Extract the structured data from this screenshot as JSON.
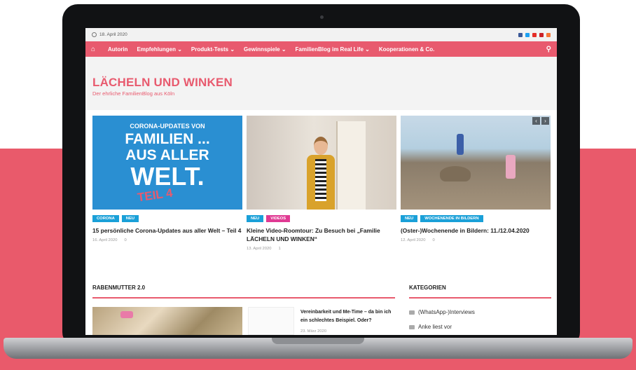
{
  "colors": {
    "accent": "#e85a6e",
    "band": "#e95a6b",
    "tag_blue": "#1aa0d8",
    "tag_pink": "#e03a93"
  },
  "topbar": {
    "date": "18. April 2020",
    "social_icons": [
      "facebook-icon",
      "twitter-icon",
      "youtube-icon",
      "pinterest-icon",
      "instagram-icon"
    ]
  },
  "nav": {
    "items": [
      "Autorin",
      "Empfehlungen ⌄",
      "Produkt-Tests ⌄",
      "Gewinnspiele ⌄",
      "FamilienBlog im Real Life ⌄",
      "Kooperationen & Co."
    ]
  },
  "site": {
    "title": "LÄCHELN UND WINKEN",
    "tagline": "Der ehrliche FamilienBlog aus Köln"
  },
  "features": [
    {
      "image_text": [
        "CORONA-UPDATES VON",
        "FAMILIEN ...",
        "AUS ALLER",
        "WELT.",
        "TEIL 4"
      ],
      "tags": [
        {
          "label": "CORONA",
          "color": "#1aa0d8"
        },
        {
          "label": "NEU",
          "color": "#1aa0d8"
        }
      ],
      "title": "15 persönliche Corona-Updates aus aller Welt – Teil 4",
      "date": "16. April 2020",
      "comments": "0"
    },
    {
      "tags": [
        {
          "label": "NEU",
          "color": "#1aa0d8"
        },
        {
          "label": "VIDEOS",
          "color": "#e03a93"
        }
      ],
      "title": "Kleine Video-Roomtour: Zu Besuch bei „Familie LÄCHELN UND WINKEN“",
      "date": "13. April 2020",
      "comments": "1"
    },
    {
      "tags": [
        {
          "label": "NEU",
          "color": "#1aa0d8"
        },
        {
          "label": "WOCHENENDE IN BILDERN",
          "color": "#1aa0d8"
        }
      ],
      "title": "(Oster-)Wochenende in Bildern: 11./12.04.2020",
      "date": "12. April 2020",
      "comments": "0"
    }
  ],
  "sections": {
    "left": {
      "title": "RABENMUTTER 2.0",
      "post_title": "Vereinbarkeit und Me-Time – da bin ich ein schlechtes Beispiel. Oder?",
      "post_date": "23. März 2020"
    },
    "right": {
      "title": "KATEGORIEN",
      "items": [
        "(WhatsApp-)Interviews",
        "Anke liest vor"
      ]
    }
  }
}
